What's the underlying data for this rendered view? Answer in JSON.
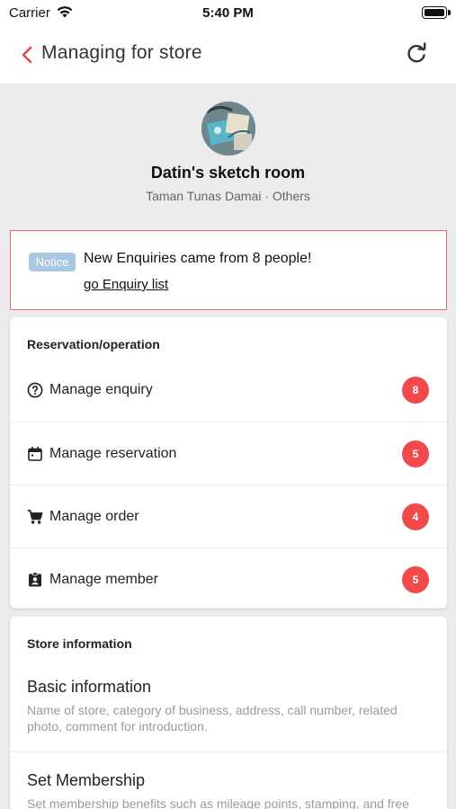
{
  "status_bar": {
    "carrier": "Carrier",
    "time": "5:40 PM"
  },
  "nav": {
    "title": "Managing for store"
  },
  "store": {
    "name": "Datin's sketch room",
    "location": "Taman Tunas Damai",
    "category": "Others",
    "meta": "Taman Tunas Damai · Others"
  },
  "notice": {
    "badge": "Notice",
    "message": "New Enquiries came from 8 people!",
    "link": "go Enquiry list"
  },
  "operations": {
    "title": "Reservation/operation",
    "items": [
      {
        "label": "Manage enquiry",
        "icon": "question-circle-icon",
        "count": "8"
      },
      {
        "label": "Manage reservation",
        "icon": "calendar-icon",
        "count": "5"
      },
      {
        "label": "Manage order",
        "icon": "cart-icon",
        "count": "4"
      },
      {
        "label": "Manage member",
        "icon": "member-badge-icon",
        "count": "5"
      }
    ]
  },
  "store_info": {
    "title": "Store information",
    "items": [
      {
        "title": "Basic information",
        "desc": "Name of store, category of business, address, call number, related photo, comment for introduction."
      },
      {
        "title": "Set Membership",
        "desc": "Set membership benefits such as mileage points, stamping, and free"
      }
    ]
  },
  "colors": {
    "accent_red": "#f24a4a",
    "notice_border": "#e8666b",
    "notice_badge": "#a9c7e3",
    "background": "#ececee"
  }
}
